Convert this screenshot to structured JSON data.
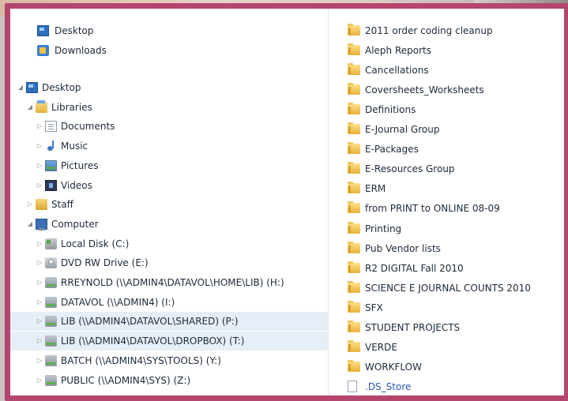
{
  "nav_pane": {
    "favorites": [
      {
        "label": "Desktop",
        "icon": "desktop-icon"
      },
      {
        "label": "Downloads",
        "icon": "downloads-icon"
      }
    ],
    "tree": [
      {
        "label": "Desktop",
        "icon": "desktop-icon",
        "level": 0,
        "expander": "expanded"
      },
      {
        "label": "Libraries",
        "icon": "libraries-icon",
        "level": 1,
        "expander": "expanded"
      },
      {
        "label": "Documents",
        "icon": "documents-icon",
        "level": 2,
        "expander": "collapsed"
      },
      {
        "label": "Music",
        "icon": "music-icon",
        "level": 2,
        "expander": "collapsed"
      },
      {
        "label": "Pictures",
        "icon": "pictures-icon",
        "level": 2,
        "expander": "collapsed"
      },
      {
        "label": "Videos",
        "icon": "videos-icon",
        "level": 2,
        "expander": "collapsed"
      },
      {
        "label": "Staff",
        "icon": "staff-folder-icon",
        "level": 1,
        "expander": "collapsed"
      },
      {
        "label": "Computer",
        "icon": "computer-icon",
        "level": 1,
        "expander": "expanded"
      },
      {
        "label": "Local Disk (C:)",
        "icon": "local-disk-icon",
        "level": 2,
        "expander": "collapsed"
      },
      {
        "label": "DVD RW Drive (E:)",
        "icon": "dvd-drive-icon",
        "level": 2,
        "expander": "collapsed"
      },
      {
        "label": "RREYNOLD (\\\\ADMIN4\\DATAVOL\\HOME\\LIB) (H:)",
        "icon": "network-drive-icon",
        "level": 2,
        "expander": "collapsed"
      },
      {
        "label": "DATAVOL (\\\\ADMIN4) (I:)",
        "icon": "network-drive-icon",
        "level": 2,
        "expander": "collapsed"
      },
      {
        "label": "LIB (\\\\ADMIN4\\DATAVOL\\SHARED) (P:)",
        "icon": "network-drive-icon",
        "level": 2,
        "expander": "collapsed",
        "selected": true
      },
      {
        "label": "LIB (\\\\ADMIN4\\DATAVOL\\DROPBOX) (T:)",
        "icon": "network-drive-icon",
        "level": 2,
        "expander": "collapsed",
        "selected": true
      },
      {
        "label": "BATCH (\\\\ADMIN4\\SYS\\TOOLS) (Y:)",
        "icon": "network-drive-icon",
        "level": 2,
        "expander": "collapsed"
      },
      {
        "label": "PUBLIC (\\\\ADMIN4\\SYS) (Z:)",
        "icon": "network-drive-icon",
        "level": 2,
        "expander": "collapsed"
      }
    ]
  },
  "content_pane": {
    "items": [
      {
        "label": "2011 order coding cleanup",
        "icon": "folder-icon"
      },
      {
        "label": "Aleph Reports",
        "icon": "folder-icon"
      },
      {
        "label": "Cancellations",
        "icon": "folder-icon"
      },
      {
        "label": "Coversheets_Worksheets",
        "icon": "folder-icon"
      },
      {
        "label": "Definitions",
        "icon": "folder-icon"
      },
      {
        "label": "E-Journal Group",
        "icon": "folder-icon"
      },
      {
        "label": "E-Packages",
        "icon": "folder-icon"
      },
      {
        "label": "E-Resources Group",
        "icon": "folder-icon"
      },
      {
        "label": "ERM",
        "icon": "folder-icon"
      },
      {
        "label": "from PRINT to ONLINE 08-09",
        "icon": "folder-icon"
      },
      {
        "label": "Printing",
        "icon": "folder-icon"
      },
      {
        "label": "Pub Vendor lists",
        "icon": "folder-icon"
      },
      {
        "label": "R2 DIGITAL Fall 2010",
        "icon": "folder-icon"
      },
      {
        "label": "SCIENCE E JOURNAL COUNTS 2010",
        "icon": "folder-icon"
      },
      {
        "label": "SFX",
        "icon": "folder-icon"
      },
      {
        "label": "STUDENT PROJECTS",
        "icon": "folder-icon"
      },
      {
        "label": "VERDE",
        "icon": "folder-icon"
      },
      {
        "label": "WORKFLOW",
        "icon": "folder-icon"
      },
      {
        "label": ".DS_Store",
        "icon": "file-icon"
      }
    ]
  },
  "colors": {
    "frame_border": "#b4456f",
    "selection": "#e6eef7",
    "text": "#1c2a3a",
    "hidden_file_text": "#2a59b8"
  }
}
